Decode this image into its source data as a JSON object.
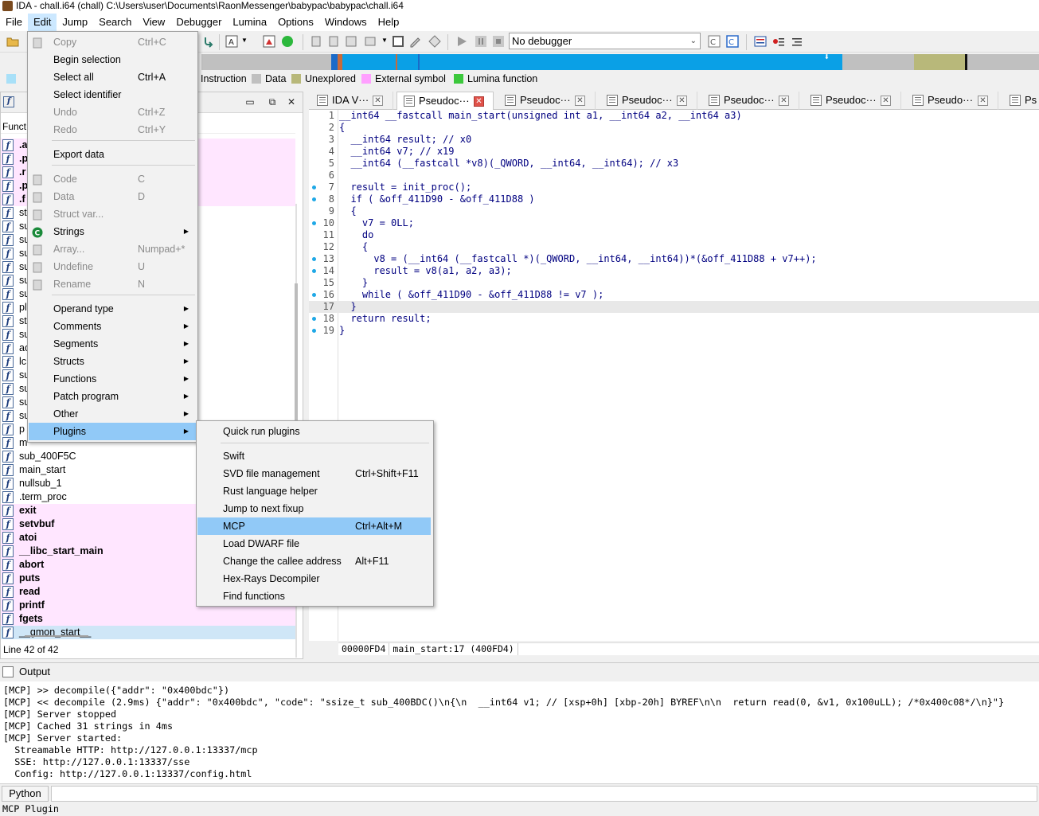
{
  "window": {
    "title": "IDA - chall.i64 (chall) C:\\Users\\user\\Documents\\RaonMessenger\\babypac\\babypac\\chall.i64"
  },
  "menubar": [
    "File",
    "Edit",
    "Jump",
    "Search",
    "View",
    "Debugger",
    "Lumina",
    "Options",
    "Windows",
    "Help"
  ],
  "toolbar": {
    "debugger_select": "No debugger"
  },
  "legend": [
    {
      "label": "Instruction",
      "color": "#c0c0c0"
    },
    {
      "label": "Data",
      "color": "#c0c0c0"
    },
    {
      "label": "Unexplored",
      "color": "#b8b87a"
    },
    {
      "label": "External symbol",
      "color": "#ffa0ff"
    },
    {
      "label": "Lumina function",
      "color": "#3cc83c"
    }
  ],
  "functions_pane": {
    "column_header": "Funct",
    "rows": [
      {
        "name": ".a",
        "lib": true
      },
      {
        "name": ".p",
        "lib": true
      },
      {
        "name": ".r",
        "lib": true
      },
      {
        "name": ".p",
        "lib": true
      },
      {
        "name": ".f",
        "lib": true
      },
      {
        "name": "st",
        "lib": false
      },
      {
        "name": "su",
        "lib": false
      },
      {
        "name": "su",
        "lib": false
      },
      {
        "name": "su",
        "lib": false
      },
      {
        "name": "su",
        "lib": false
      },
      {
        "name": "su",
        "lib": false
      },
      {
        "name": "su",
        "lib": false
      },
      {
        "name": "pl",
        "lib": false
      },
      {
        "name": "st",
        "lib": false
      },
      {
        "name": "su",
        "lib": false
      },
      {
        "name": "ac",
        "lib": false
      },
      {
        "name": "lc",
        "lib": false
      },
      {
        "name": "su",
        "lib": false
      },
      {
        "name": "su",
        "lib": false
      },
      {
        "name": "su",
        "lib": false
      },
      {
        "name": "su",
        "lib": false
      },
      {
        "name": "p",
        "lib": false
      },
      {
        "name": "m",
        "lib": false
      },
      {
        "name": "sub_400F5C",
        "lib": false
      },
      {
        "name": "main_start",
        "lib": false
      },
      {
        "name": "nullsub_1",
        "lib": false
      },
      {
        "name": ".term_proc",
        "lib": false
      },
      {
        "name": "exit",
        "lib": true
      },
      {
        "name": "setvbuf",
        "lib": true
      },
      {
        "name": "atoi",
        "lib": true
      },
      {
        "name": "__libc_start_main",
        "lib": true
      },
      {
        "name": "abort",
        "lib": true
      },
      {
        "name": "puts",
        "lib": true
      },
      {
        "name": "read",
        "lib": true
      },
      {
        "name": "printf",
        "lib": true
      },
      {
        "name": "fgets",
        "lib": true
      },
      {
        "name": "__gmon_start__",
        "lib": false,
        "selected": true
      }
    ],
    "status": "Line 42 of 42"
  },
  "tabs": [
    {
      "label": "IDA V···",
      "active": false
    },
    {
      "label": "Pseudoc···",
      "active": true
    },
    {
      "label": "Pseudoc···",
      "active": false
    },
    {
      "label": "Pseudoc···",
      "active": false
    },
    {
      "label": "Pseudoc···",
      "active": false
    },
    {
      "label": "Pseudoc···",
      "active": false
    },
    {
      "label": "Pseudo···",
      "active": false
    },
    {
      "label": "Ps",
      "active": false
    }
  ],
  "code_lines": [
    {
      "n": "1",
      "dot": false,
      "text": "__int64 __fastcall main_start(unsigned int a1, __int64 a2, __int64 a3)"
    },
    {
      "n": "2",
      "dot": false,
      "text": "{"
    },
    {
      "n": "3",
      "dot": false,
      "text": "  __int64 result; // x0"
    },
    {
      "n": "4",
      "dot": false,
      "text": "  __int64 v7; // x19"
    },
    {
      "n": "5",
      "dot": false,
      "text": "  __int64 (__fastcall *v8)(_QWORD, __int64, __int64); // x3"
    },
    {
      "n": "6",
      "dot": false,
      "text": ""
    },
    {
      "n": "7",
      "dot": true,
      "text": "  result = init_proc();"
    },
    {
      "n": "8",
      "dot": true,
      "text": "  if ( &off_411D90 - &off_411D88 )"
    },
    {
      "n": "9",
      "dot": false,
      "text": "  {"
    },
    {
      "n": "10",
      "dot": true,
      "text": "    v7 = 0LL;"
    },
    {
      "n": "11",
      "dot": false,
      "text": "    do"
    },
    {
      "n": "12",
      "dot": false,
      "text": "    {"
    },
    {
      "n": "13",
      "dot": true,
      "text": "      v8 = (__int64 (__fastcall *)(_QWORD, __int64, __int64))*(&off_411D88 + v7++);"
    },
    {
      "n": "14",
      "dot": true,
      "text": "      result = v8(a1, a2, a3);"
    },
    {
      "n": "15",
      "dot": false,
      "text": "    }"
    },
    {
      "n": "16",
      "dot": true,
      "text": "    while ( &off_411D90 - &off_411D88 != v7 );"
    },
    {
      "n": "17",
      "dot": false,
      "text": "  }",
      "current": true
    },
    {
      "n": "18",
      "dot": true,
      "text": "  return result;"
    },
    {
      "n": "19",
      "dot": true,
      "text": "}"
    }
  ],
  "code_status": {
    "offset": "00000FD4",
    "location": "main_start:17 (400FD4)"
  },
  "output": {
    "title": "Output",
    "lines": [
      "[MCP] >> decompile({\"addr\": \"0x400bdc\"})",
      "[MCP] << decompile (2.9ms) {\"addr\": \"0x400bdc\", \"code\": \"ssize_t sub_400BDC()\\n{\\n  __int64 v1; // [xsp+0h] [xbp-20h] BYREF\\n\\n  return read(0, &v1, 0x100uLL); /*0x400c08*/\\n}\"}",
      "[MCP] Server stopped",
      "[MCP] Cached 31 strings in 4ms",
      "[MCP] Server started:",
      "  Streamable HTTP: http://127.0.0.1:13337/mcp",
      "  SSE: http://127.0.0.1:13337/sse",
      "  Config: http://127.0.0.1:13337/config.html"
    ],
    "cli_language": "Python"
  },
  "statusbar": "MCP Plugin",
  "edit_menu": {
    "items": [
      {
        "label": "Copy",
        "shortcut": "Ctrl+C",
        "disabled": true,
        "icon": "copy-icon"
      },
      {
        "label": "Begin selection",
        "shortcut": "",
        "disabled": false
      },
      {
        "label": "Select all",
        "shortcut": "Ctrl+A",
        "disabled": false
      },
      {
        "label": "Select identifier",
        "shortcut": "",
        "disabled": false
      },
      {
        "label": "Undo",
        "shortcut": "Ctrl+Z",
        "disabled": true
      },
      {
        "label": "Redo",
        "shortcut": "Ctrl+Y",
        "disabled": true
      },
      {
        "label": "Export data",
        "shortcut": "",
        "disabled": false
      },
      {
        "label": "Code",
        "shortcut": "C",
        "disabled": true,
        "icon": "code-icon"
      },
      {
        "label": "Data",
        "shortcut": "D",
        "disabled": true,
        "icon": "data-icon"
      },
      {
        "label": "Struct var...",
        "shortcut": "",
        "disabled": true,
        "icon": "struct-icon"
      },
      {
        "label": "Strings",
        "shortcut": "",
        "disabled": false,
        "submenu": true,
        "icon": "strings-icon"
      },
      {
        "label": "Array...",
        "shortcut": "Numpad+*",
        "disabled": true,
        "icon": "array-icon"
      },
      {
        "label": "Undefine",
        "shortcut": "U",
        "disabled": true,
        "icon": "undefine-icon"
      },
      {
        "label": "Rename",
        "shortcut": "N",
        "disabled": true,
        "icon": "rename-icon"
      },
      {
        "label": "Operand type",
        "shortcut": "",
        "disabled": false,
        "submenu": true
      },
      {
        "label": "Comments",
        "shortcut": "",
        "disabled": false,
        "submenu": true
      },
      {
        "label": "Segments",
        "shortcut": "",
        "disabled": false,
        "submenu": true
      },
      {
        "label": "Structs",
        "shortcut": "",
        "disabled": false,
        "submenu": true
      },
      {
        "label": "Functions",
        "shortcut": "",
        "disabled": false,
        "submenu": true
      },
      {
        "label": "Patch program",
        "shortcut": "",
        "disabled": false,
        "submenu": true
      },
      {
        "label": "Other",
        "shortcut": "",
        "disabled": false,
        "submenu": true
      },
      {
        "label": "Plugins",
        "shortcut": "",
        "disabled": false,
        "submenu": true,
        "highlighted": true
      }
    ]
  },
  "plugins_menu": {
    "items": [
      {
        "label": "Quick run plugins",
        "shortcut": ""
      },
      {
        "label": "Swift",
        "shortcut": ""
      },
      {
        "label": "SVD file management",
        "shortcut": "Ctrl+Shift+F11"
      },
      {
        "label": "Rust language helper",
        "shortcut": ""
      },
      {
        "label": "Jump to next fixup",
        "shortcut": ""
      },
      {
        "label": "MCP",
        "shortcut": "Ctrl+Alt+M",
        "highlighted": true
      },
      {
        "label": "Load DWARF file",
        "shortcut": ""
      },
      {
        "label": "Change the callee address",
        "shortcut": "Alt+F11"
      },
      {
        "label": "Hex-Rays Decompiler",
        "shortcut": ""
      },
      {
        "label": "Find functions",
        "shortcut": ""
      }
    ]
  }
}
